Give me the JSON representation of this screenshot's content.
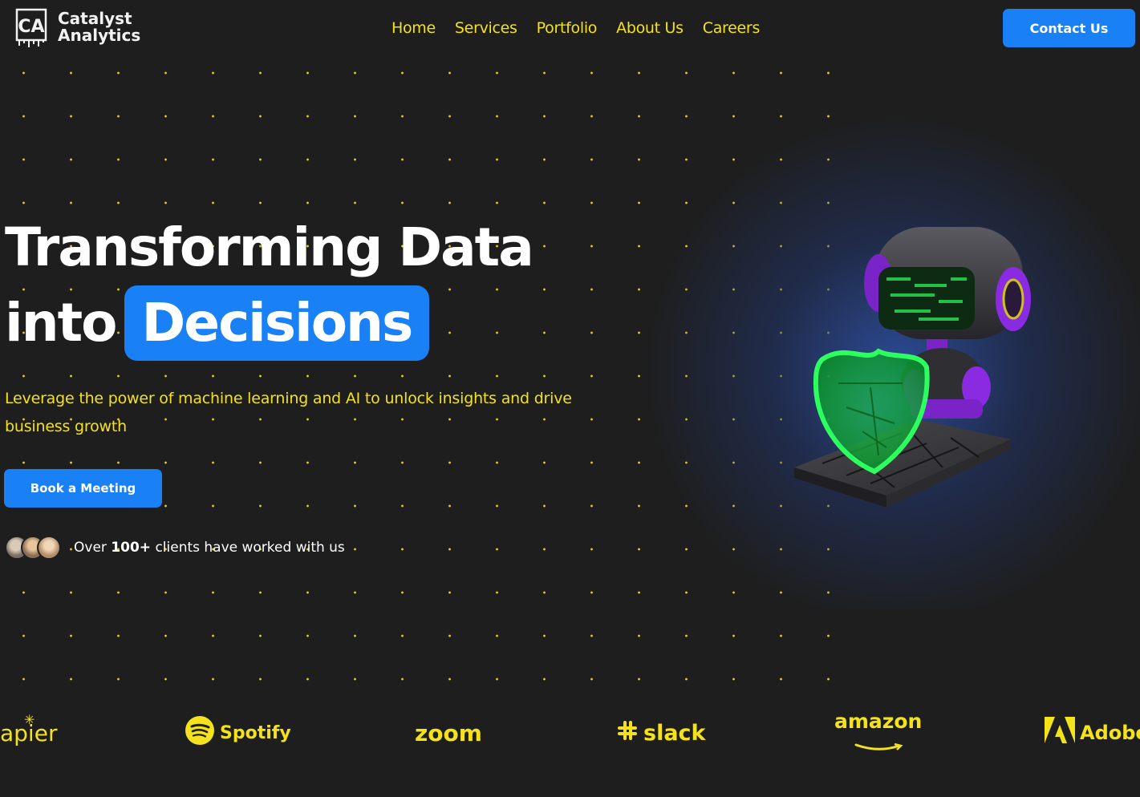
{
  "header": {
    "logo_line1": "Catalyst",
    "logo_line2": "Analytics",
    "logo_mark_text": "CA",
    "nav": [
      {
        "label": "Home"
      },
      {
        "label": "Services"
      },
      {
        "label": "Portfolio"
      },
      {
        "label": "About Us"
      },
      {
        "label": "Careers"
      }
    ],
    "contact_label": "Contact Us"
  },
  "hero": {
    "title_line1": "Transforming Data",
    "title_line2_plain": "into",
    "title_line2_highlight": "Decisions",
    "subtitle": "Leverage the power of machine learning and AI to unlock insights and drive business growth",
    "cta_label": "Book a Meeting",
    "clients_prefix": "Over",
    "clients_count": "100+",
    "clients_suffix": "clients have worked with us"
  },
  "brands": [
    {
      "name": "apier",
      "icon": "zapier-asterisk-icon"
    },
    {
      "name": "Spotify",
      "icon": "spotify-icon"
    },
    {
      "name": "zoom",
      "icon": "none"
    },
    {
      "name": "slack",
      "icon": "slack-hash-icon"
    },
    {
      "name": "amazon",
      "icon": "amazon-smile-icon"
    },
    {
      "name": "Adobe",
      "icon": "adobe-a-icon"
    }
  ],
  "colors": {
    "background": "#1e1e1e",
    "accent_blue": "#1a80f5",
    "accent_yellow": "#f3e21c",
    "text_white": "#ffffff"
  }
}
